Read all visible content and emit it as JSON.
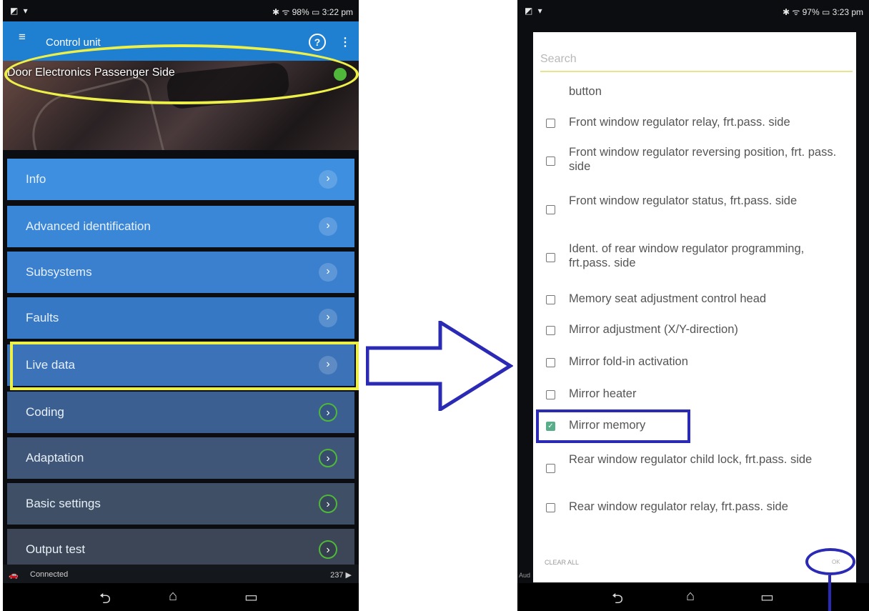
{
  "left": {
    "status": {
      "icons": "◩ ▾",
      "right": "✱ ᯤ 98% ▭ 3:22 pm"
    },
    "appbar": {
      "menu_glyph": "≡",
      "title": "Control unit",
      "help_glyph": "?",
      "more_glyph": "⋮"
    },
    "header": {
      "title": "Door Electronics Passenger Side",
      "status_color": "#4fb83a"
    },
    "menu": [
      {
        "label": "Info",
        "chevron": "›",
        "style": "filled"
      },
      {
        "label": "Advanced identification",
        "chevron": "›",
        "style": "filled"
      },
      {
        "label": "Subsystems",
        "chevron": "›",
        "style": "filled"
      },
      {
        "label": "Faults",
        "chevron": "›",
        "style": "filled"
      },
      {
        "label": "Live data",
        "chevron": "›",
        "style": "filled"
      },
      {
        "label": "Coding",
        "chevron": "›",
        "style": "ring"
      },
      {
        "label": "Adaptation",
        "chevron": "›",
        "style": "ring"
      },
      {
        "label": "Basic settings",
        "chevron": "›",
        "style": "ring"
      },
      {
        "label": "Output test",
        "chevron": "›",
        "style": "ring"
      }
    ],
    "footer": {
      "car_glyph": "🚗",
      "status": "Connected",
      "count": "237 ▶"
    },
    "nav": {
      "back": "⮌",
      "home": "⌂",
      "recent": "▭"
    }
  },
  "right": {
    "status": {
      "icons": "◩ ▾",
      "right": "✱ ᯤ 97% ▭ 3:23 pm"
    },
    "dialog": {
      "search_placeholder": "Search",
      "partial_top": "button",
      "items": [
        {
          "label": "Front window regulator relay, frt.pass. side",
          "checked": false
        },
        {
          "label": "Front window regulator reversing position, frt. pass. side",
          "checked": false
        },
        {
          "label": "Front window regulator status, frt.pass. side",
          "checked": false
        },
        {
          "label": "Ident. of rear window regulator programming, frt.pass. side",
          "checked": false
        },
        {
          "label": "Memory seat adjustment control head",
          "checked": false
        },
        {
          "label": "Mirror adjustment (X/Y-direction)",
          "checked": false
        },
        {
          "label": "Mirror fold-in activation",
          "checked": false
        },
        {
          "label": "Mirror heater",
          "checked": false
        },
        {
          "label": "Mirror memory",
          "checked": true
        },
        {
          "label": "Rear window regulator child lock, frt.pass. side",
          "checked": false
        },
        {
          "label": "Rear window regulator relay, frt.pass. side",
          "checked": false
        }
      ],
      "clear_all": "CLEAR ALL",
      "ok": "OK"
    },
    "footer_dim": "Aud",
    "nav": {
      "back": "⮌",
      "home": "⌂",
      "recent": "▭"
    }
  },
  "colors": {
    "appbar": "#1f7fd0",
    "highlight_yellow": "#eef04a",
    "annotation_blue": "#2a2ab5"
  }
}
